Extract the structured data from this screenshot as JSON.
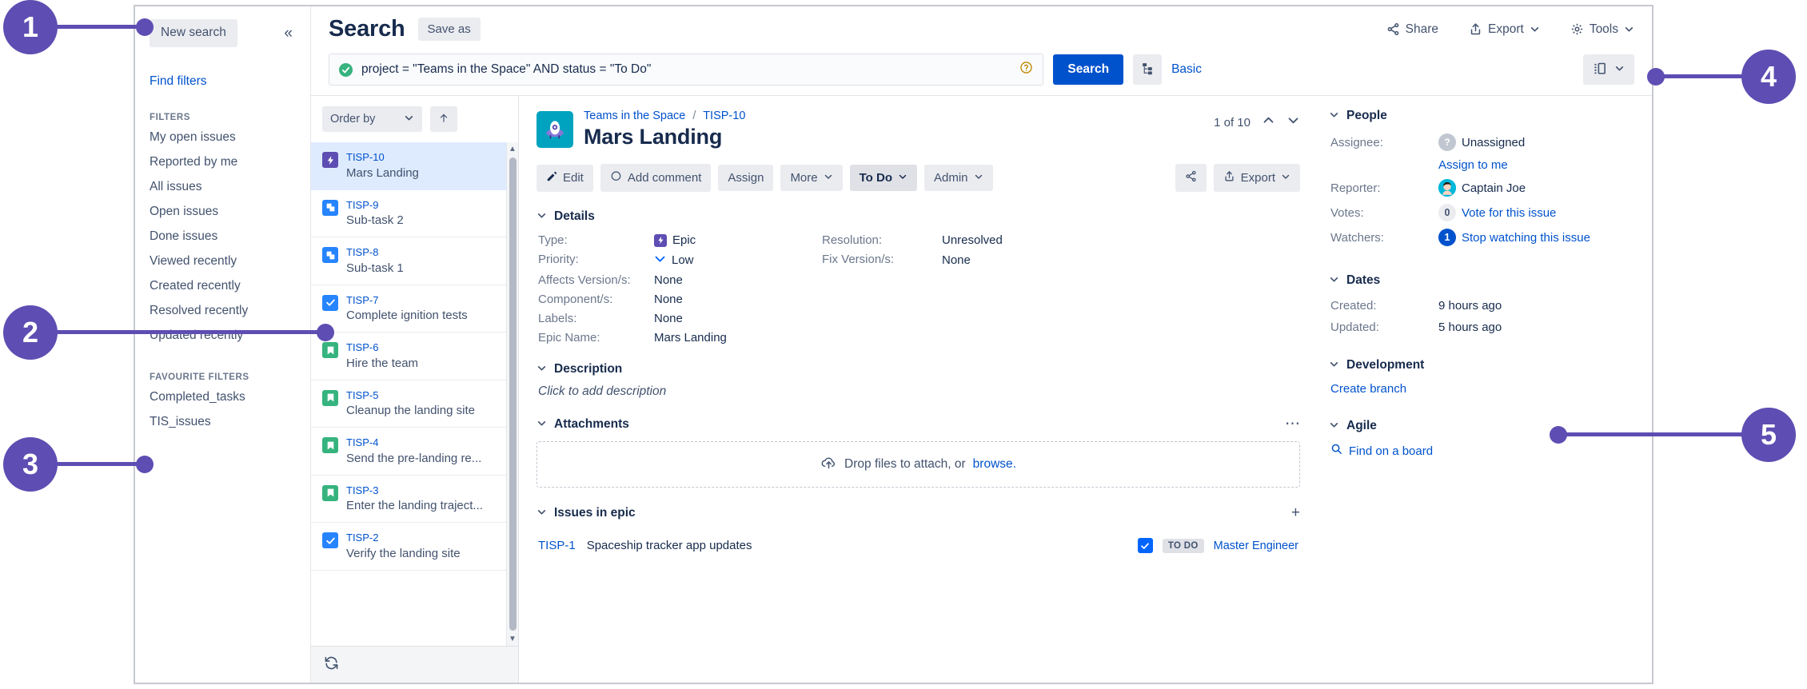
{
  "callouts": [
    {
      "num": "1"
    },
    {
      "num": "2"
    },
    {
      "num": "3"
    },
    {
      "num": "4"
    },
    {
      "num": "5"
    }
  ],
  "sidebar": {
    "new_search_label": "New search",
    "collapse_icon": "chevron-double-left",
    "find_filters_label": "Find filters",
    "filters_heading": "FILTERS",
    "filters": [
      {
        "label": "My open issues"
      },
      {
        "label": "Reported by me"
      },
      {
        "label": "All issues"
      },
      {
        "label": "Open issues"
      },
      {
        "label": "Done issues"
      },
      {
        "label": "Viewed recently"
      },
      {
        "label": "Created recently"
      },
      {
        "label": "Resolved recently"
      },
      {
        "label": "Updated recently"
      }
    ],
    "favourite_heading": "FAVOURITE FILTERS",
    "favourites": [
      {
        "label": "Completed_tasks"
      },
      {
        "label": "TIS_issues"
      }
    ]
  },
  "header": {
    "title": "Search",
    "save_as_label": "Save as",
    "share_label": "Share",
    "export_label": "Export",
    "tools_label": "Tools"
  },
  "search": {
    "jql_value": "project = \"Teams in the Space\" AND status = \"To Do\"",
    "jql_valid_icon": "check-circle-icon",
    "help_icon": "question-circle-icon",
    "search_button": "Search",
    "structure_icon": "issue-hierarchy-icon",
    "basic_label": "Basic",
    "columns_icon": "columns-icon"
  },
  "issue_list": {
    "order_by_label": "Order by",
    "sort_direction_icon": "arrow-up-icon",
    "refresh_icon": "refresh-icon",
    "rows": [
      {
        "key": "TISP-10",
        "summary": "Mars Landing",
        "type": "epic",
        "selected": true
      },
      {
        "key": "TISP-9",
        "summary": "Sub-task 2",
        "type": "subtask",
        "selected": false
      },
      {
        "key": "TISP-8",
        "summary": "Sub-task 1",
        "type": "subtask",
        "selected": false
      },
      {
        "key": "TISP-7",
        "summary": "Complete ignition tests",
        "type": "task",
        "selected": false
      },
      {
        "key": "TISP-6",
        "summary": "Hire the team",
        "type": "story",
        "selected": false
      },
      {
        "key": "TISP-5",
        "summary": "Cleanup the landing site",
        "type": "story",
        "selected": false
      },
      {
        "key": "TISP-4",
        "summary": "Send the pre-landing re...",
        "type": "story",
        "selected": false
      },
      {
        "key": "TISP-3",
        "summary": "Enter the landing traject...",
        "type": "story",
        "selected": false
      },
      {
        "key": "TISP-2",
        "summary": "Verify the landing site",
        "type": "task",
        "selected": false
      }
    ]
  },
  "issue": {
    "project_name": "Teams in the Space",
    "breadcrumb_sep": "/",
    "key": "TISP-10",
    "title": "Mars Landing",
    "pager_text": "1 of 10",
    "prev_icon": "chevron-up-icon",
    "next_icon": "chevron-down-icon",
    "actions": {
      "edit": "Edit",
      "add_comment": "Add comment",
      "assign": "Assign",
      "more": "More",
      "status": "To Do",
      "admin": "Admin",
      "share_icon": "share-icon",
      "export": "Export"
    },
    "details": {
      "heading": "Details",
      "type_label": "Type:",
      "type_value": "Epic",
      "priority_label": "Priority:",
      "priority_value": "Low",
      "affects_label": "Affects Version/s:",
      "affects_value": "None",
      "component_label": "Component/s:",
      "component_value": "None",
      "labels_label": "Labels:",
      "labels_value": "None",
      "epic_name_label": "Epic Name:",
      "epic_name_value": "Mars Landing",
      "resolution_label": "Resolution:",
      "resolution_value": "Unresolved",
      "fix_version_label": "Fix Version/s:",
      "fix_version_value": "None"
    },
    "description": {
      "heading": "Description",
      "placeholder": "Click to add description"
    },
    "attachments": {
      "heading": "Attachments",
      "more_icon": "ellipsis-icon",
      "drop_text": "Drop files to attach, or",
      "browse_label": "browse.",
      "upload_icon": "cloud-upload-icon"
    },
    "issues_in_epic": {
      "heading": "Issues in epic",
      "add_icon": "plus-icon",
      "rows": [
        {
          "key": "TISP-1",
          "summary": "Spaceship tracker app updates",
          "status": "TO DO",
          "assignee": "Master Engineer"
        }
      ]
    },
    "people": {
      "heading": "People",
      "assignee_label": "Assignee:",
      "assignee_value": "Unassigned",
      "assign_to_me": "Assign to me",
      "reporter_label": "Reporter:",
      "reporter_value": "Captain Joe",
      "votes_label": "Votes:",
      "votes_count": "0",
      "votes_link": "Vote for this issue",
      "watchers_label": "Watchers:",
      "watchers_count": "1",
      "watchers_link": "Stop watching this issue"
    },
    "dates": {
      "heading": "Dates",
      "created_label": "Created:",
      "created_value": "9 hours ago",
      "updated_label": "Updated:",
      "updated_value": "5 hours ago"
    },
    "development": {
      "heading": "Development",
      "create_branch": "Create branch"
    },
    "agile": {
      "heading": "Agile",
      "find_on_board": "Find on a board",
      "search_icon": "magnifier-icon"
    }
  },
  "colors": {
    "accent_purple": "#5e4db2",
    "link_blue": "#0052cc",
    "primary_blue": "#0065ff",
    "green": "#36b37e",
    "teal": "#00a3bf",
    "selected_row": "#deebff"
  }
}
